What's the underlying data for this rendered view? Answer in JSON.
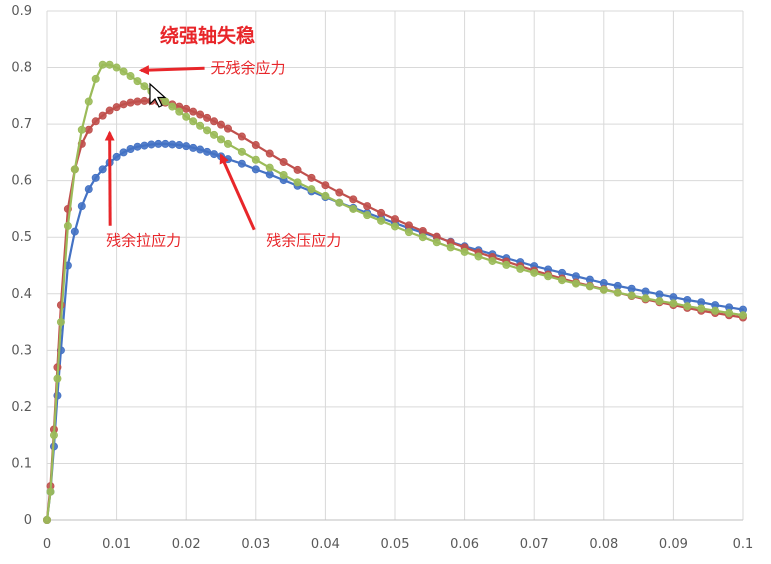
{
  "chart_data": {
    "type": "scatter",
    "title": "绕强轴失稳",
    "xlim": [
      0,
      0.1
    ],
    "ylim": [
      0,
      0.9
    ],
    "xticks": [
      "0",
      "0.01",
      "0.02",
      "0.03",
      "0.04",
      "0.05",
      "0.06",
      "0.07",
      "0.08",
      "0.09",
      "0.1"
    ],
    "yticks": [
      "0",
      "0.1",
      "0.2",
      "0.3",
      "0.4",
      "0.5",
      "0.6",
      "0.7",
      "0.8",
      "0.9"
    ],
    "grid": true,
    "legend": "none",
    "series": [
      {
        "name": "残余压应力",
        "color": "#4472c4",
        "x": [
          0,
          0.0005,
          0.001,
          0.0015,
          0.002,
          0.003,
          0.004,
          0.005,
          0.006,
          0.007,
          0.008,
          0.009,
          0.01,
          0.011,
          0.012,
          0.013,
          0.014,
          0.015,
          0.016,
          0.017,
          0.018,
          0.019,
          0.02,
          0.021,
          0.022,
          0.023,
          0.024,
          0.025,
          0.026,
          0.028,
          0.03,
          0.032,
          0.034,
          0.036,
          0.038,
          0.04,
          0.042,
          0.044,
          0.046,
          0.048,
          0.05,
          0.052,
          0.054,
          0.056,
          0.058,
          0.06,
          0.062,
          0.064,
          0.066,
          0.068,
          0.07,
          0.072,
          0.074,
          0.076,
          0.078,
          0.08,
          0.082,
          0.084,
          0.086,
          0.088,
          0.09,
          0.092,
          0.094,
          0.096,
          0.098,
          0.1
        ],
        "y": [
          0,
          0.05,
          0.13,
          0.22,
          0.3,
          0.45,
          0.51,
          0.555,
          0.585,
          0.605,
          0.62,
          0.632,
          0.642,
          0.65,
          0.656,
          0.66,
          0.662,
          0.664,
          0.665,
          0.665,
          0.664,
          0.663,
          0.661,
          0.658,
          0.655,
          0.651,
          0.647,
          0.643,
          0.638,
          0.63,
          0.62,
          0.611,
          0.601,
          0.591,
          0.581,
          0.571,
          0.561,
          0.552,
          0.543,
          0.534,
          0.525,
          0.516,
          0.508,
          0.5,
          0.492,
          0.484,
          0.477,
          0.47,
          0.463,
          0.456,
          0.449,
          0.443,
          0.437,
          0.431,
          0.425,
          0.419,
          0.414,
          0.409,
          0.404,
          0.399,
          0.394,
          0.389,
          0.385,
          0.38,
          0.376,
          0.372
        ]
      },
      {
        "name": "残余拉应力",
        "color": "#c0504d",
        "x": [
          0,
          0.0005,
          0.001,
          0.0015,
          0.002,
          0.003,
          0.004,
          0.005,
          0.006,
          0.007,
          0.008,
          0.009,
          0.01,
          0.011,
          0.012,
          0.013,
          0.014,
          0.015,
          0.016,
          0.017,
          0.018,
          0.019,
          0.02,
          0.021,
          0.022,
          0.023,
          0.024,
          0.025,
          0.026,
          0.028,
          0.03,
          0.032,
          0.034,
          0.036,
          0.038,
          0.04,
          0.042,
          0.044,
          0.046,
          0.048,
          0.05,
          0.052,
          0.054,
          0.056,
          0.058,
          0.06,
          0.062,
          0.064,
          0.066,
          0.068,
          0.07,
          0.072,
          0.074,
          0.076,
          0.078,
          0.08,
          0.082,
          0.084,
          0.086,
          0.088,
          0.09,
          0.092,
          0.094,
          0.096,
          0.098,
          0.1
        ],
        "y": [
          0,
          0.06,
          0.16,
          0.27,
          0.38,
          0.55,
          0.62,
          0.665,
          0.69,
          0.705,
          0.715,
          0.724,
          0.73,
          0.735,
          0.738,
          0.74,
          0.741,
          0.741,
          0.74,
          0.738,
          0.735,
          0.731,
          0.727,
          0.722,
          0.717,
          0.711,
          0.705,
          0.699,
          0.692,
          0.678,
          0.663,
          0.648,
          0.633,
          0.619,
          0.605,
          0.592,
          0.579,
          0.567,
          0.555,
          0.543,
          0.532,
          0.521,
          0.511,
          0.501,
          0.491,
          0.482,
          0.473,
          0.465,
          0.457,
          0.449,
          0.441,
          0.434,
          0.427,
          0.42,
          0.414,
          0.408,
          0.402,
          0.396,
          0.39,
          0.385,
          0.38,
          0.375,
          0.37,
          0.366,
          0.362,
          0.358
        ]
      },
      {
        "name": "无残余应力",
        "color": "#9bbb59",
        "x": [
          0,
          0.0005,
          0.001,
          0.0015,
          0.002,
          0.003,
          0.004,
          0.005,
          0.006,
          0.007,
          0.008,
          0.009,
          0.01,
          0.011,
          0.012,
          0.013,
          0.014,
          0.015,
          0.016,
          0.017,
          0.018,
          0.019,
          0.02,
          0.021,
          0.022,
          0.023,
          0.024,
          0.025,
          0.026,
          0.028,
          0.03,
          0.032,
          0.034,
          0.036,
          0.038,
          0.04,
          0.042,
          0.044,
          0.046,
          0.048,
          0.05,
          0.052,
          0.054,
          0.056,
          0.058,
          0.06,
          0.062,
          0.064,
          0.066,
          0.068,
          0.07,
          0.072,
          0.074,
          0.076,
          0.078,
          0.08,
          0.082,
          0.084,
          0.086,
          0.088,
          0.09,
          0.092,
          0.094,
          0.096,
          0.098,
          0.1
        ],
        "y": [
          0,
          0.05,
          0.15,
          0.25,
          0.35,
          0.52,
          0.62,
          0.69,
          0.74,
          0.78,
          0.805,
          0.805,
          0.8,
          0.793,
          0.785,
          0.776,
          0.767,
          0.758,
          0.749,
          0.74,
          0.731,
          0.722,
          0.713,
          0.705,
          0.697,
          0.689,
          0.681,
          0.673,
          0.665,
          0.651,
          0.637,
          0.623,
          0.61,
          0.597,
          0.585,
          0.573,
          0.561,
          0.55,
          0.539,
          0.529,
          0.519,
          0.509,
          0.5,
          0.491,
          0.482,
          0.474,
          0.466,
          0.458,
          0.451,
          0.444,
          0.437,
          0.431,
          0.424,
          0.418,
          0.413,
          0.407,
          0.402,
          0.397,
          0.392,
          0.387,
          0.383,
          0.378,
          0.374,
          0.37,
          0.366,
          0.362
        ]
      }
    ],
    "annotations": [
      {
        "text": "无残余应力",
        "x": 0.0235,
        "y": 0.79,
        "arrow_to": [
          0.0135,
          0.795
        ]
      },
      {
        "text": "残余拉应力",
        "x": 0.0085,
        "y": 0.485,
        "arrow_to": [
          0.009,
          0.685
        ]
      },
      {
        "text": "残余压应力",
        "x": 0.0315,
        "y": 0.485,
        "arrow_to": [
          0.025,
          0.645
        ]
      }
    ]
  }
}
